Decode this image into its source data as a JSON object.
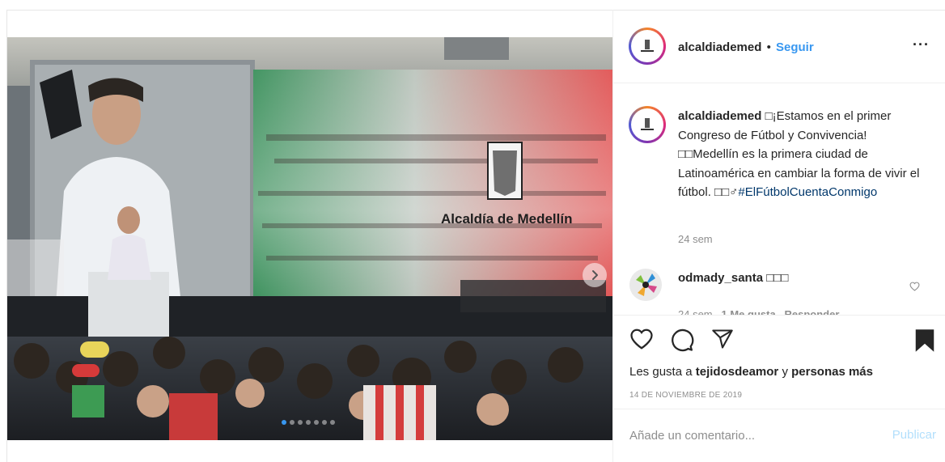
{
  "post": {
    "username": "alcaldiademed",
    "separator": "•",
    "follow_label": "Seguir",
    "more_label": "···",
    "image": {
      "screen_logo_text": "Alcaldía de Medellín",
      "carousel_count": 7,
      "carousel_active": 1
    },
    "caption": {
      "username": "alcaldiademed",
      "text": "□¡Estamos en el primer Congreso de Fútbol y Convivencia! □□Medellín es la primera ciudad de Latinoamérica en cambiar la forma de vivir el fútbol. □□♂",
      "hashtag": "#ElFútbolCuentaConmigo",
      "time": "24 sem"
    },
    "comments": [
      {
        "username": "odmady_santa",
        "text": "□□□",
        "time": "24 sem",
        "likes": "1 Me gusta",
        "reply_label": "Responder"
      }
    ],
    "likes": {
      "prefix": "Les gusta a",
      "user": "tejidosdeamor",
      "conj": "y",
      "others": "personas más"
    },
    "date": "14 DE NOVIEMBRE DE 2019",
    "add_comment": {
      "placeholder": "Añade un comentario...",
      "publish_label": "Publicar"
    }
  },
  "colors": {
    "accent": "#3897f0",
    "publish_disabled": "#b2dffc",
    "muted": "#8e8e8e",
    "border": "#efefef"
  }
}
